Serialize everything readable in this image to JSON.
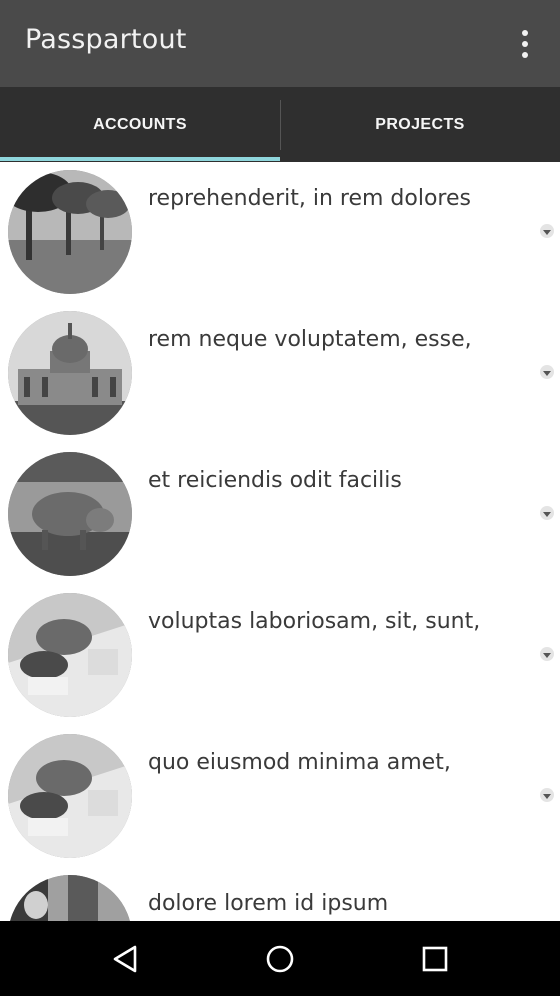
{
  "appbar": {
    "title": "Passpartout",
    "overflow_icon": "more-vert-icon"
  },
  "tabs": [
    {
      "label": "ACCOUNTS",
      "selected": true
    },
    {
      "label": "PROJECTS",
      "selected": false
    }
  ],
  "accent_color": "#8fd6dc",
  "list": {
    "items": [
      {
        "text": "reprehenderit, in rem dolores",
        "image": "trees"
      },
      {
        "text": "rem neque voluptatem, esse,",
        "image": "dome-building"
      },
      {
        "text": "et reiciendis odit facilis",
        "image": "pig"
      },
      {
        "text": "voluptas laboriosam, sit, sunt,",
        "image": "food"
      },
      {
        "text": "quo eiusmod minima amet,",
        "image": "food"
      },
      {
        "text": "dolore lorem id ipsum",
        "image": "people"
      }
    ]
  },
  "navbar": {
    "back_icon": "back-icon",
    "home_icon": "home-icon",
    "recents_icon": "recents-icon"
  }
}
